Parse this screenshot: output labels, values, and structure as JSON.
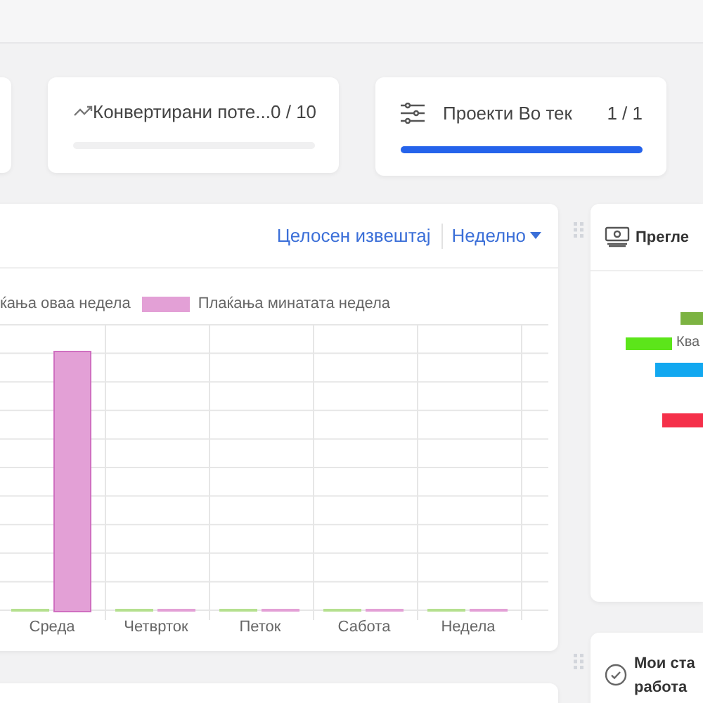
{
  "kpi_cards": [
    {
      "title": "Конвертирани поте...",
      "count": "0 / 10",
      "level": 0
    },
    {
      "title": "Проекти Во тек",
      "count": "1 / 1",
      "level": 1
    }
  ],
  "payments_card": {
    "report_link": "Целосен извештај",
    "period_dropdown": "Неделно",
    "legend": [
      {
        "label": "ќања оваа недела"
      },
      {
        "label": "Плаќања минатата недела",
        "color": "#e3a0d6"
      }
    ],
    "x_labels": [
      "Среда",
      "Четврток",
      "Петок",
      "Сабота",
      "Недела"
    ]
  },
  "overview_card": {
    "title": "Прегле",
    "bar_label": "Ква"
  },
  "stats_card": {
    "title_lines": [
      "Мои ста",
      "работа"
    ]
  }
}
